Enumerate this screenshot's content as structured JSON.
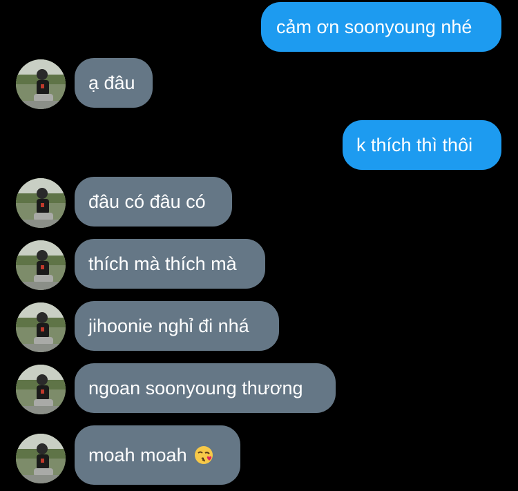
{
  "conversation": {
    "messages": [
      {
        "side": "sent",
        "text": "cảm ơn soonyoung nhé"
      },
      {
        "side": "received",
        "text": "ạ đâu"
      },
      {
        "side": "sent",
        "text": "k thích thì thôi"
      },
      {
        "side": "received",
        "text": "đâu có đâu có"
      },
      {
        "side": "received",
        "text": "thích mà thích mà"
      },
      {
        "side": "received",
        "text": "jihoonie nghỉ đi nhá"
      },
      {
        "side": "received",
        "text": "ngoan soonyoung thương"
      },
      {
        "side": "received",
        "text": "moah moah",
        "emoji": "kissing-face-icon"
      }
    ]
  },
  "colors": {
    "background": "#000000",
    "sent_bubble": "#1d9bf0",
    "received_bubble": "#657786",
    "text": "#ffffff"
  }
}
